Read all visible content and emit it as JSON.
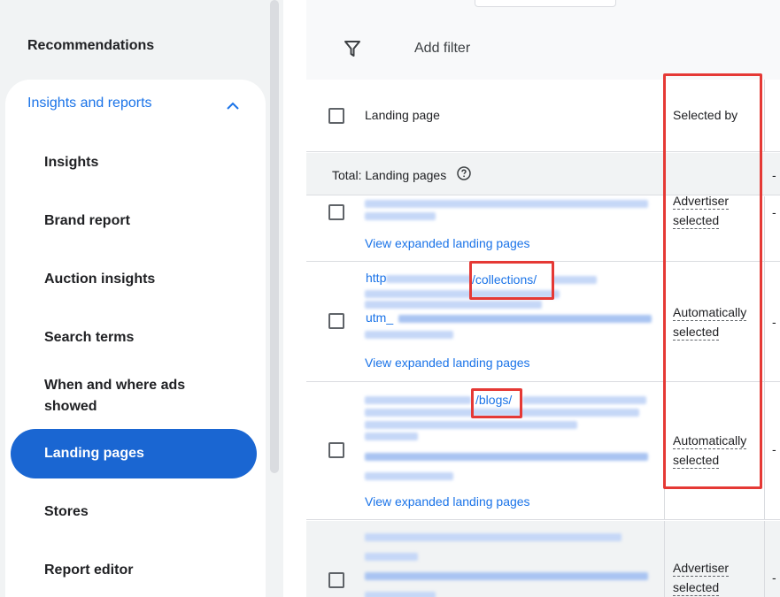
{
  "sidebar": {
    "top_item": "Recommendations",
    "group_label": "Insights and reports",
    "items": [
      {
        "label": "Insights"
      },
      {
        "label": "Brand report"
      },
      {
        "label": "Auction insights"
      },
      {
        "label": "Search terms"
      },
      {
        "label": "When and where ads showed"
      },
      {
        "label": "Landing pages",
        "active": true
      },
      {
        "label": "Stores"
      },
      {
        "label": "Report editor"
      }
    ]
  },
  "toolbar": {
    "add_filter_label": "Add filter"
  },
  "table": {
    "columns": [
      "Landing page",
      "Selected by"
    ],
    "total_label": "Total: Landing pages",
    "total_value": "-",
    "rows": [
      {
        "url_fragment": "",
        "view_link": "View expanded landing pages",
        "selected_by": [
          "Advertiser",
          "selected"
        ],
        "value": "-"
      },
      {
        "url_fragment": "/collections/",
        "url_prefix": "http",
        "url_mid": "utm_",
        "view_link": "View expanded landing pages",
        "selected_by": [
          "Automatically",
          "selected"
        ],
        "value": "-"
      },
      {
        "url_fragment": "/blogs/",
        "view_link": "View expanded landing pages",
        "selected_by": [
          "Automatically",
          "selected"
        ],
        "value": "-"
      },
      {
        "url_fragment": "",
        "view_link": "",
        "selected_by": [
          "Advertiser",
          "selected"
        ],
        "value": "-"
      }
    ]
  },
  "colors": {
    "accent": "#1a73e8",
    "active_nav": "#1a66d2",
    "annotation": "#e53935"
  }
}
